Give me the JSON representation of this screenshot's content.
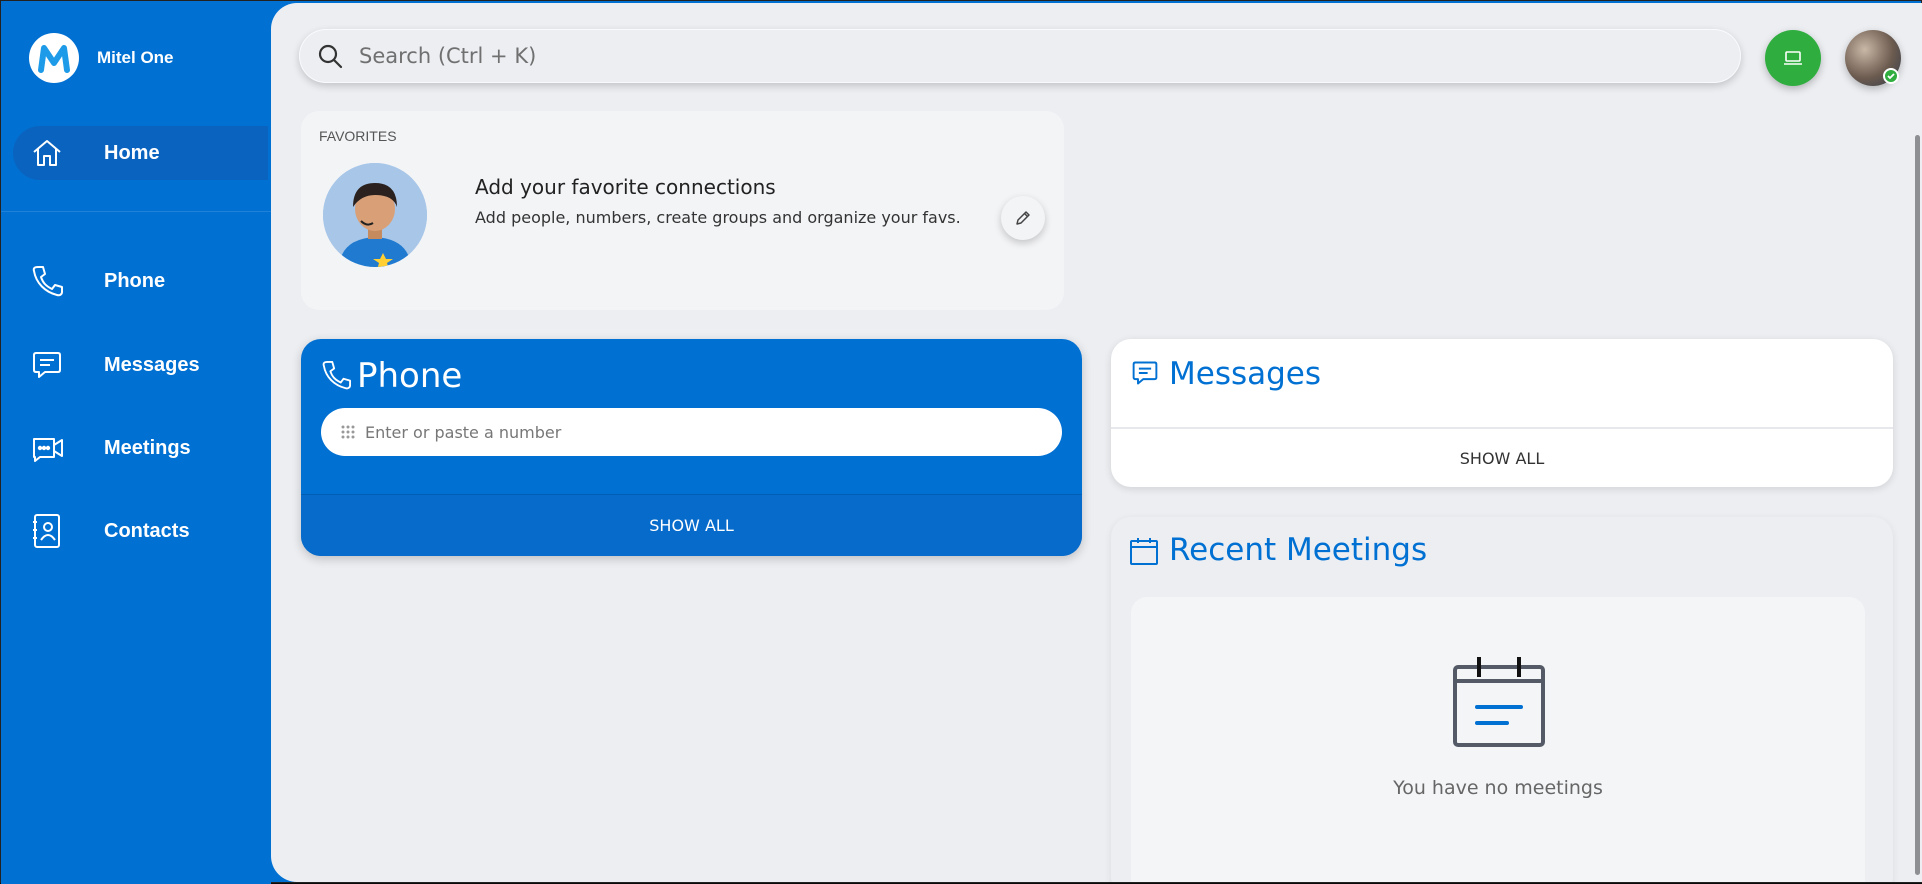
{
  "brand": {
    "name": "Mitel One",
    "logo_letter": "M"
  },
  "sidebar": {
    "items": [
      {
        "label": "Home",
        "icon": "home-icon",
        "active": true
      },
      {
        "label": "Phone",
        "icon": "phone-icon"
      },
      {
        "label": "Messages",
        "icon": "message-icon"
      },
      {
        "label": "Meetings",
        "icon": "video-icon"
      },
      {
        "label": "Contacts",
        "icon": "contacts-icon"
      }
    ]
  },
  "header": {
    "search_placeholder": "Search (Ctrl + K)",
    "device_button_icon": "laptop-icon",
    "presence_status": "available"
  },
  "favorites": {
    "title": "FAVORITES",
    "heading": "Add your favorite connections",
    "subtitle": "Add people, numbers, create groups and organize your favs.",
    "edit_icon": "pencil-icon"
  },
  "phone": {
    "title": "Phone",
    "input_placeholder": "Enter or paste a number",
    "show_all": "SHOW ALL"
  },
  "messages": {
    "title": "Messages",
    "show_all": "SHOW ALL"
  },
  "meetings": {
    "title": "Recent Meetings",
    "empty_text": "You have no meetings"
  },
  "colors": {
    "brand_blue": "#0070d2",
    "surface": "#eceef2",
    "status_green": "#2fae3f"
  }
}
